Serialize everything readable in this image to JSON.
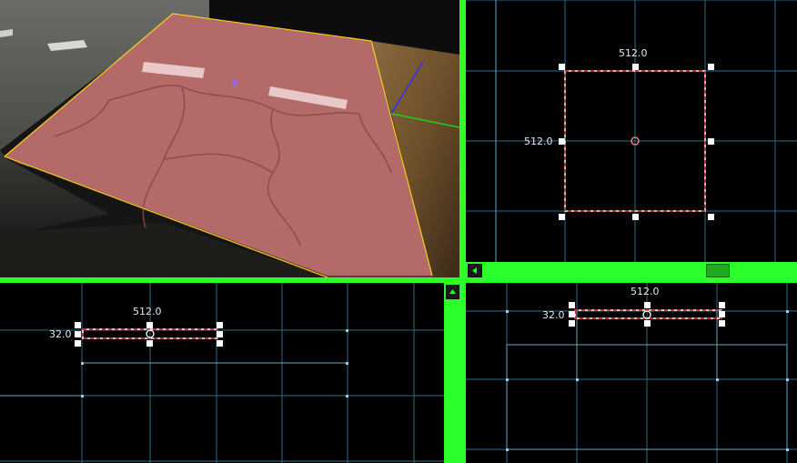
{
  "viewports": {
    "top": {
      "width_label": "512.0",
      "height_label": "512.0"
    },
    "front": {
      "width_label": "512.0",
      "height_label": "32.0"
    },
    "side": {
      "width_label": "512.0",
      "height_label": "32.0"
    }
  },
  "colors": {
    "separator": "#2aff2a",
    "grid_major": "#2f6a8a",
    "grid_minor": "#6fa6c0",
    "selection_outline": "#cc1a1a",
    "brush_face": "#b86a6a"
  },
  "icons": {
    "scroll_left": "triangle-left",
    "scroll_up": "triangle-up"
  }
}
